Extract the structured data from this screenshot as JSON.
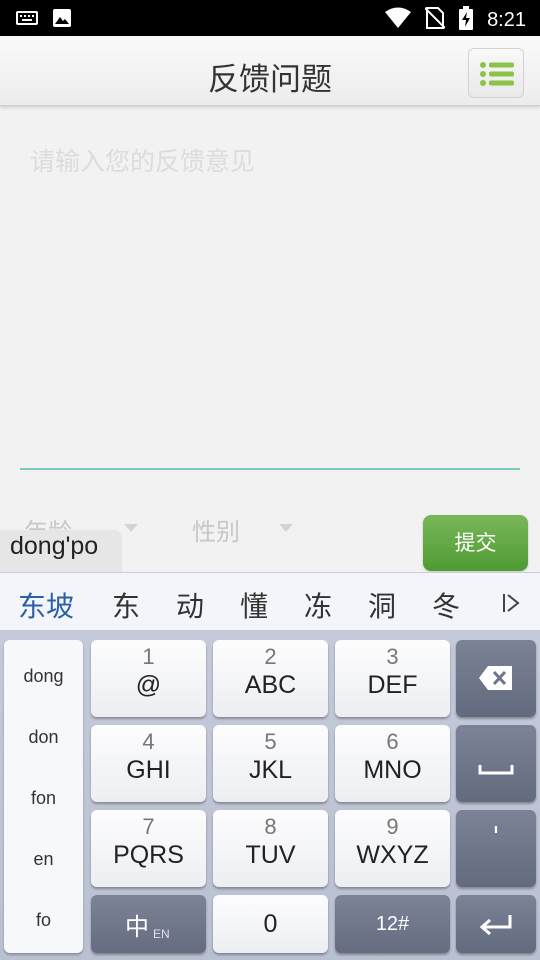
{
  "status_bar": {
    "time": "8:21",
    "left_icons": [
      "keyboard-icon",
      "image-icon"
    ],
    "right_icons": [
      "wifi-icon",
      "no-sim-icon",
      "battery-charging-icon"
    ]
  },
  "app_bar": {
    "title": "反馈问题",
    "menu_icon": "list-icon",
    "accent_color": "#8bc34a"
  },
  "form": {
    "feedback_placeholder": "请输入您的反馈意见",
    "age_label": "年龄",
    "gender_label": "性别",
    "submit_label": "提交",
    "submit_color": "#5fa83e",
    "underline_color": "#7fc9c4"
  },
  "ime": {
    "composing_text": "dong'po",
    "candidates": [
      "东坡",
      "东",
      "动",
      "懂",
      "冻",
      "洞",
      "冬"
    ],
    "pinyin_options": [
      "dong",
      "don",
      "fon",
      "en",
      "fo"
    ],
    "keys": [
      {
        "num": "1",
        "letters": "@"
      },
      {
        "num": "2",
        "letters": "ABC"
      },
      {
        "num": "3",
        "letters": "DEF"
      },
      {
        "num": "4",
        "letters": "GHI"
      },
      {
        "num": "5",
        "letters": "JKL"
      },
      {
        "num": "6",
        "letters": "MNO"
      },
      {
        "num": "7",
        "letters": "PQRS"
      },
      {
        "num": "8",
        "letters": "TUV"
      },
      {
        "num": "9",
        "letters": "WXYZ"
      }
    ],
    "lang_key": {
      "main": "中",
      "sub": "EN"
    },
    "zero_key": "0",
    "symbol_key": "12#",
    "apostrophe_key": "'",
    "function_icons": [
      "backspace-icon",
      "space-icon",
      "enter-icon"
    ]
  }
}
